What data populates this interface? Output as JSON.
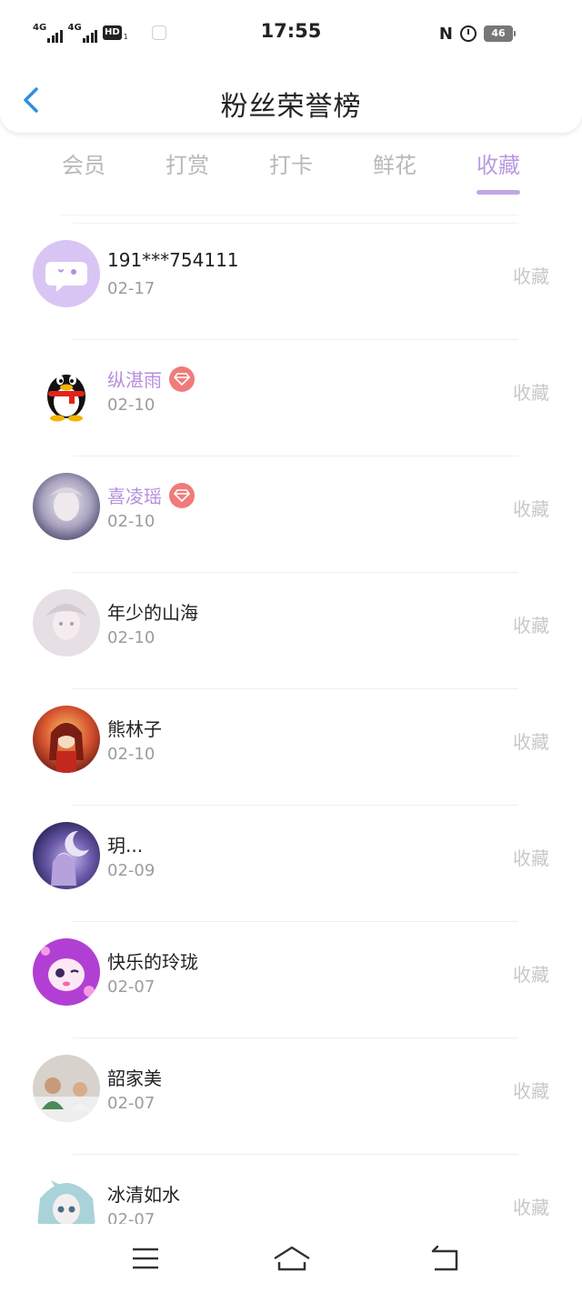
{
  "status_bar": {
    "signal1": "4G",
    "signal2": "4G",
    "hd": "HD",
    "sim": "1",
    "time": "17:55",
    "nfc": "N",
    "battery": "46"
  },
  "header": {
    "title": "粉丝荣誉榜"
  },
  "tabs": [
    {
      "label": "会员",
      "active": false
    },
    {
      "label": "打赏",
      "active": false
    },
    {
      "label": "打卡",
      "active": false
    },
    {
      "label": "鲜花",
      "active": false
    },
    {
      "label": "收藏",
      "active": true
    }
  ],
  "items": [
    {
      "name": "191***754111",
      "date": "02-17",
      "action": "收藏",
      "vip": false
    },
    {
      "name": "纵湛雨",
      "date": "02-10",
      "action": "收藏",
      "vip": true
    },
    {
      "name": "喜凌瑶",
      "date": "02-10",
      "action": "收藏",
      "vip": true
    },
    {
      "name": "年少的山海",
      "date": "02-10",
      "action": "收藏",
      "vip": false
    },
    {
      "name": "熊林子",
      "date": "02-10",
      "action": "收藏",
      "vip": false
    },
    {
      "name": "玥...",
      "date": "02-09",
      "action": "收藏",
      "vip": false
    },
    {
      "name": "快乐的玲珑",
      "date": "02-07",
      "action": "收藏",
      "vip": false
    },
    {
      "name": "韶家美",
      "date": "02-07",
      "action": "收藏",
      "vip": false
    },
    {
      "name": "冰清如水",
      "date": "02-07",
      "action": "收藏",
      "vip": false
    }
  ],
  "colors": {
    "accent": "#b99ae0",
    "back_arrow": "#2f8fe0",
    "gem": "#f07b7b"
  }
}
